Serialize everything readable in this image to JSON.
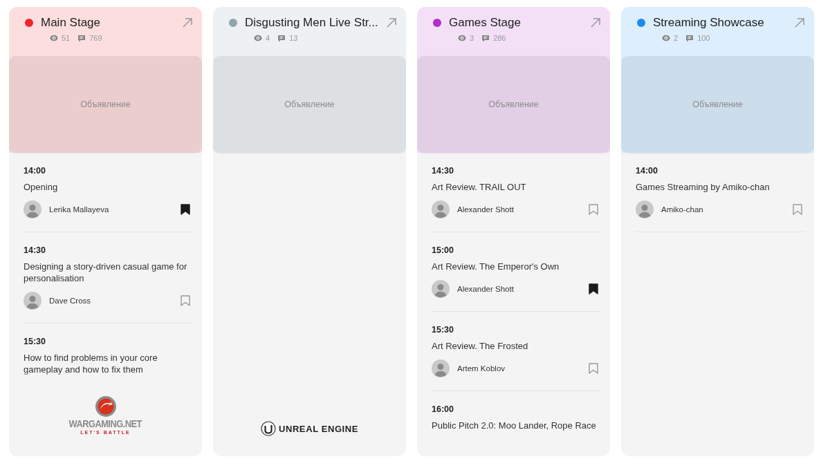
{
  "stages": [
    {
      "name": "Main Stage",
      "color": "#f0252a",
      "views": "51",
      "comments": "769",
      "ad": "Объявление",
      "sessions": [
        {
          "time": "14:00",
          "title": "Opening",
          "speaker": "Lerika Mallayeva",
          "bookmarked": true
        },
        {
          "time": "14:30",
          "title": "Designing a story-driven casual game for personalisation",
          "speaker": "Dave Cross",
          "bookmarked": false
        },
        {
          "time": "15:30",
          "title": "How to find problems in your core gameplay and how to fix them"
        }
      ],
      "sponsor": {
        "kind": "wargaming",
        "name": "WARGAMING.NET",
        "slogan": "LET'S BATTLE"
      }
    },
    {
      "name": "Disgusting Men Live Str...",
      "color": "#90a4ae",
      "views": "4",
      "comments": "13",
      "ad": "Объявление",
      "sponsor": {
        "kind": "unreal",
        "name": "UNREAL ENGINE"
      }
    },
    {
      "name": "Games Stage",
      "color": "#b02fc9",
      "views": "3",
      "comments": "286",
      "ad": "Объявление",
      "sessions": [
        {
          "time": "14:30",
          "title": "Art Review. TRAIL OUT",
          "speaker": "Alexander Shott",
          "bookmarked": false
        },
        {
          "time": "15:00",
          "title": "Art Review. The Emperor's Own",
          "speaker": "Alexander Shott",
          "bookmarked": true
        },
        {
          "time": "15:30",
          "title": "Art Review. The Frosted",
          "speaker": "Artem Koblov",
          "bookmarked": false
        },
        {
          "time": "16:00",
          "title": "Public Pitch 2.0: Moo Lander, Rope Race"
        }
      ]
    },
    {
      "name": "Streaming Showcase",
      "color": "#1a8cf0",
      "views": "2",
      "comments": "100",
      "ad": "Объявление",
      "sessions": [
        {
          "time": "14:00",
          "title": "Games Streaming by Amiko-chan",
          "speaker": "Amiko-chan",
          "bookmarked": false
        }
      ]
    }
  ]
}
